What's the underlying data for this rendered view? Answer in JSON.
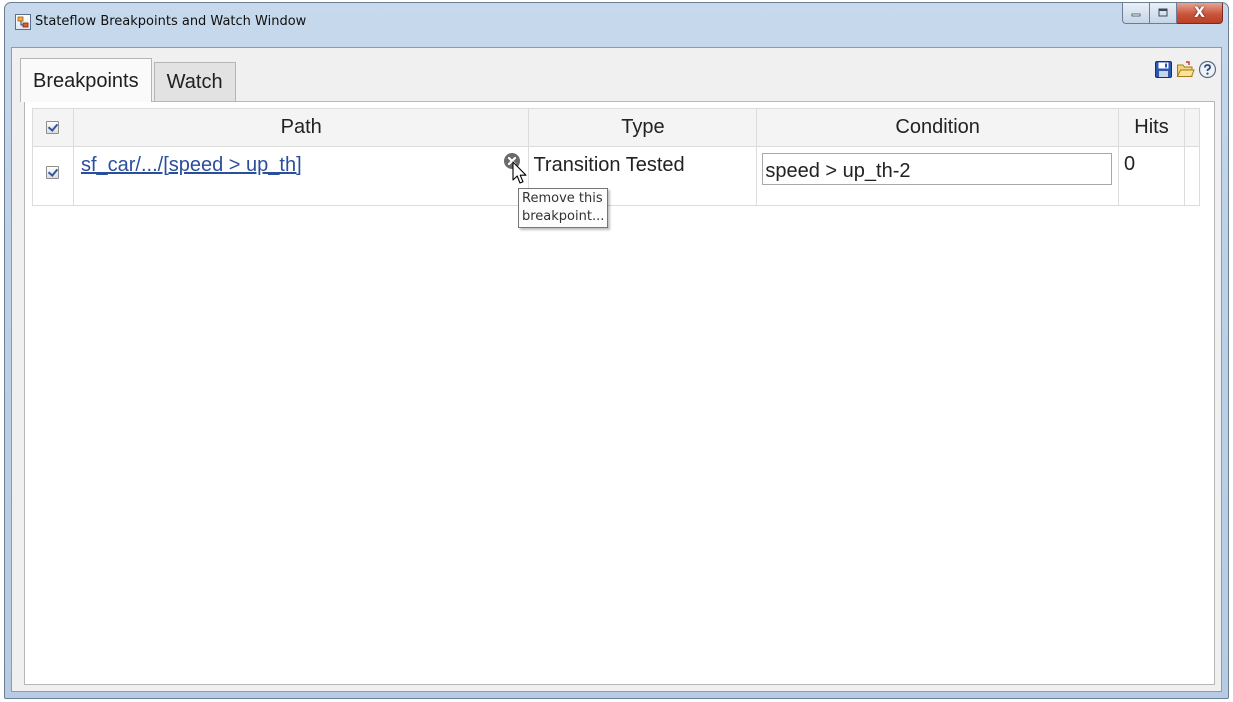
{
  "window": {
    "title": "Stateflow Breakpoints and Watch Window"
  },
  "title_controls": {
    "minimize": "minimize-icon",
    "maximize": "maximize-icon",
    "close_label": "X"
  },
  "tabs": [
    {
      "label": "Breakpoints",
      "active": true
    },
    {
      "label": "Watch",
      "active": false
    }
  ],
  "toolbar": [
    "save-icon",
    "open-folder-icon",
    "help-icon"
  ],
  "table": {
    "columns": [
      "Path",
      "Type",
      "Condition",
      "Hits"
    ],
    "rows": [
      {
        "enabled": true,
        "path": "sf_car/.../[speed > up_th]",
        "type": "Transition Tested",
        "condition": "speed > up_th-2",
        "hits": "0"
      }
    ]
  },
  "tooltip": {
    "line1": "Remove this",
    "line2": "breakpoint..."
  }
}
